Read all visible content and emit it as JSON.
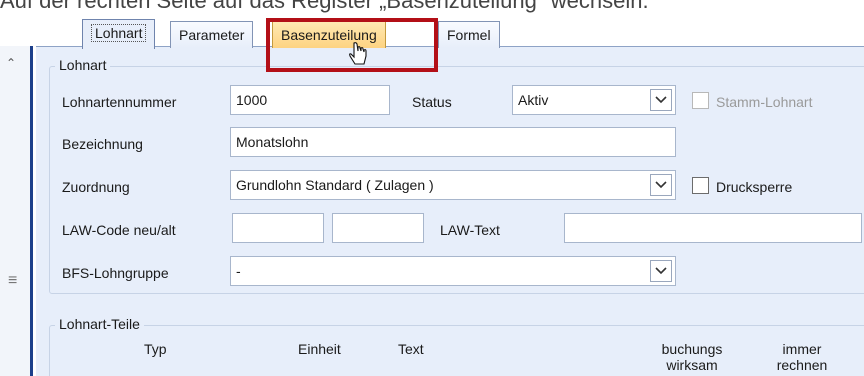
{
  "caption": "Auf der rechten Seite auf das Register „Basenzuteilung\" wechseln.",
  "tabs": [
    {
      "label": "Lohnart"
    },
    {
      "label": "Parameter"
    },
    {
      "label": "Basenzuteilung"
    },
    {
      "label": "Formel"
    }
  ],
  "lohnart_group": {
    "title": "Lohnart",
    "lohnartennummer_label": "Lohnartennummer",
    "lohnartennummer_value": "1000",
    "status_label": "Status",
    "status_value": "Aktiv",
    "stamm_lohnart_label": "Stamm-Lohnart",
    "bezeichnung_label": "Bezeichnung",
    "bezeichnung_value": "Monatslohn",
    "zuordnung_label": "Zuordnung",
    "zuordnung_value": "Grundlohn Standard ( Zulagen )",
    "drucksperre_label": "Drucksperre",
    "law_code_label": "LAW-Code neu/alt",
    "law_code_neu_value": "",
    "law_code_alt_value": "",
    "law_text_label": "LAW-Text",
    "law_text_value": "",
    "bfs_label": "BFS-Lohngruppe",
    "bfs_value": "-"
  },
  "teile_group": {
    "title": "Lohnart-Teile",
    "columns": [
      "Typ",
      "Einheit",
      "Text",
      "buchungs wirksam",
      "immer rechnen"
    ]
  },
  "icons": {
    "scroll_up": "chevron-up-icon",
    "grip": "grip-lines-icon",
    "dropdown": "chevron-down-icon",
    "cursor": "hand-pointer-icon"
  },
  "colors": {
    "panel_bg": "#e7eefa",
    "highlight_border": "#b30f17",
    "hot_tab": "#fdd382",
    "sidebar_border": "#1c3f8a"
  }
}
